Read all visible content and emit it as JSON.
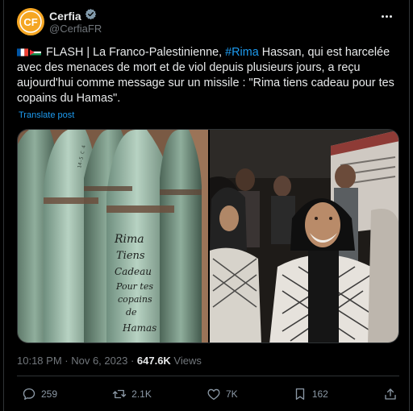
{
  "author": {
    "name": "Cerfia",
    "handle": "@CerfiaFR",
    "avatar_text": "CF",
    "avatar_color": "#f5a623"
  },
  "tweet": {
    "flags": [
      "france-flag",
      "palestine-flag"
    ],
    "text_before": "FLASH | La Franco-Palestinienne, ",
    "hashtag": "#Rima",
    "text_after": " Hassan, qui est harcelée avec des menaces de mort et de viol depuis plusieurs jours, a reçu aujourd'hui comme message sur un missile : \"Rima tiens cadeau pour tes copains du Hamas\".",
    "translate_label": "Translate post"
  },
  "media": {
    "left_handwriting": [
      "Rima",
      "Tiens",
      "Cadeau",
      "Pour tes",
      "copains",
      "de",
      "Hamas"
    ]
  },
  "meta": {
    "time": "10:18 PM",
    "date": "Nov 6, 2023",
    "separator": " · ",
    "views_count": "647.6K",
    "views_label": " Views"
  },
  "actions": {
    "replies": "259",
    "reposts": "2.1K",
    "likes": "7K",
    "bookmarks": "162"
  },
  "colors": {
    "accent": "#1d9bf0",
    "text": "#e7e9ea",
    "muted": "#71767b",
    "background": "#000000"
  }
}
